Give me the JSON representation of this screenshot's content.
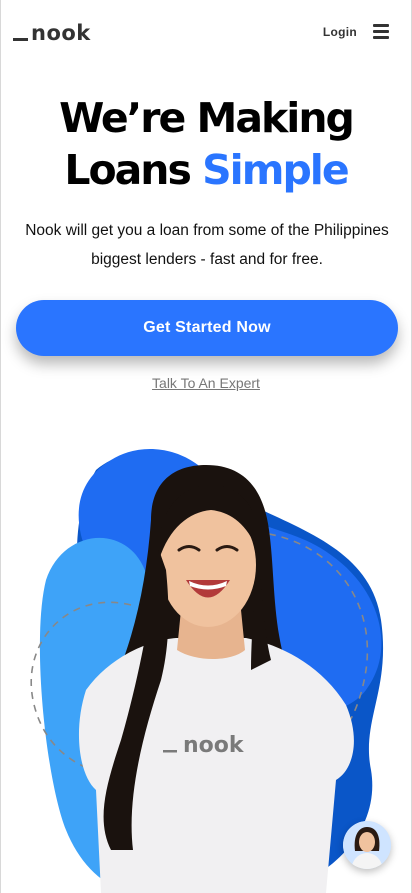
{
  "header": {
    "logo_text": "nook",
    "login_label": "Login",
    "menu_icon": "hamburger-menu-icon"
  },
  "hero": {
    "title_line1": "We’re Making",
    "title_line2_prefix": "Loans ",
    "title_line2_accent": "Simple",
    "subtitle": "Nook will get you a loan from some of the Philippines biggest lenders - fast and for free.",
    "cta_label": "Get Started Now",
    "secondary_link": "Talk To An Expert"
  },
  "illustration": {
    "shirt_logo_text": "nook"
  },
  "chat": {
    "icon": "chat-avatar-icon"
  },
  "colors": {
    "accent": "#2a75ff",
    "blob_light": "#3ea3f8",
    "blob_dark": "#0a56c8",
    "text_dark": "#000000"
  }
}
